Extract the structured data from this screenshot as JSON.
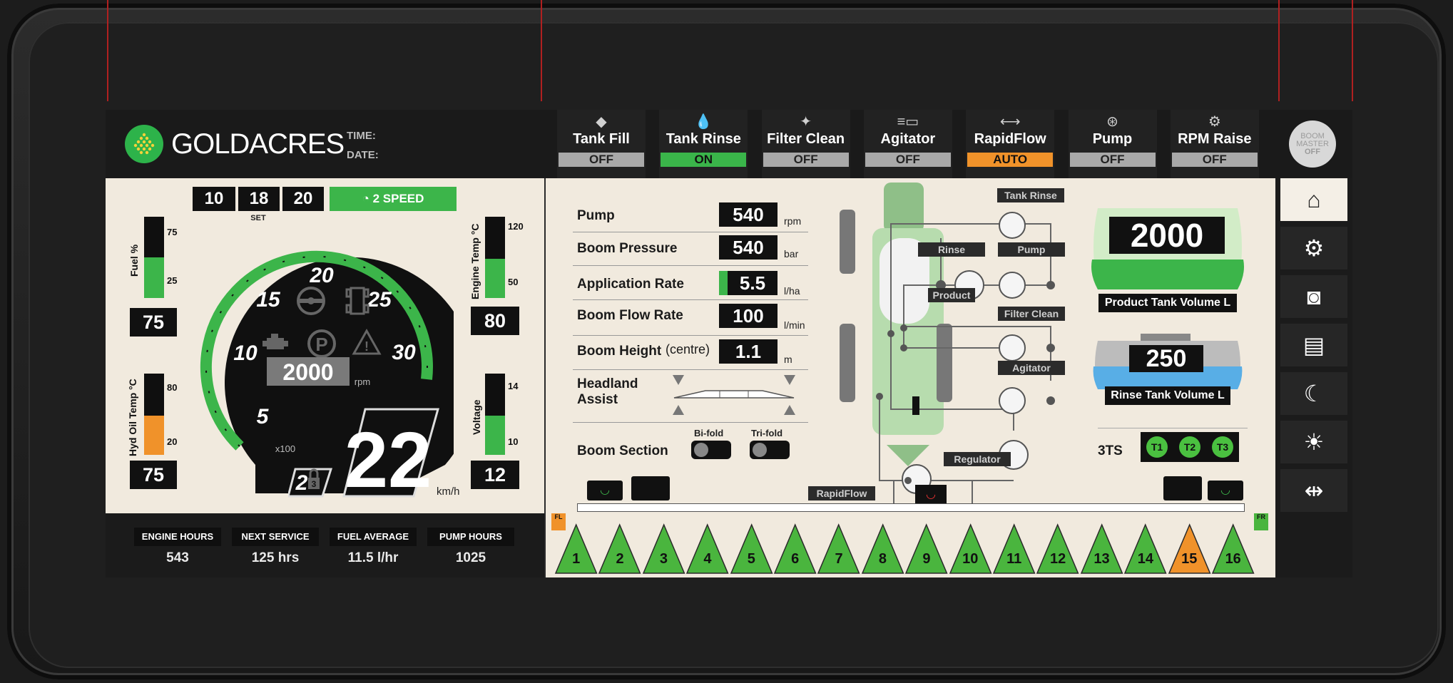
{
  "brand": {
    "name": "GOLDACRES"
  },
  "header": {
    "time_label": "TIME:",
    "date_label": "DATE:"
  },
  "functions": [
    {
      "label": "Tank Fill",
      "state": "OFF",
      "state_color": "#a9a9a9",
      "icon": "tank-fill-icon"
    },
    {
      "label": "Tank Rinse",
      "state": "ON",
      "state_color": "#3ab54a",
      "icon": "tank-rinse-icon"
    },
    {
      "label": "Filter Clean",
      "state": "OFF",
      "state_color": "#a9a9a9",
      "icon": "filter-clean-icon"
    },
    {
      "label": "Agitator",
      "state": "OFF",
      "state_color": "#a9a9a9",
      "icon": "agitator-icon"
    },
    {
      "label": "RapidFlow",
      "state": "AUTO",
      "state_color": "#f0922a",
      "icon": "rapidflow-icon"
    },
    {
      "label": "Pump",
      "state": "OFF",
      "state_color": "#a9a9a9",
      "icon": "pump-icon"
    },
    {
      "label": "RPM Raise",
      "state": "OFF",
      "state_color": "#a9a9a9",
      "icon": "rpm-raise-icon"
    }
  ],
  "boom_master": {
    "line1": "BOOM",
    "line2": "MASTER",
    "line3": "OFF"
  },
  "speed_set": {
    "values": [
      "10",
      "18",
      "20"
    ],
    "label": "SET",
    "mode": "2 SPEED"
  },
  "gauges": {
    "fuel": {
      "label": "Fuel %",
      "ticks": [
        "75",
        "25"
      ],
      "value": "75",
      "level_pct": 50
    },
    "engine_temp": {
      "label": "Engine Temp °C",
      "ticks": [
        "120",
        "50"
      ],
      "value": "80",
      "level_pct": 48
    },
    "hyd_oil_temp": {
      "label": "Hyd Oil Temp °C",
      "ticks": [
        "80",
        "20"
      ],
      "value": "75",
      "level_pct": 48
    },
    "voltage": {
      "label": "Voltage",
      "ticks": [
        "14",
        "10"
      ],
      "value": "12",
      "level_pct": 48
    }
  },
  "tacho": {
    "ticks": [
      "5",
      "10",
      "15",
      "20",
      "25",
      "30"
    ],
    "rpm": "2000",
    "rpm_unit": "rpm",
    "multiplier": "x100",
    "speed": "22",
    "speed_unit": "km/h",
    "gear": "2",
    "gear_lock": "3"
  },
  "stats": [
    {
      "label": "ENGINE HOURS",
      "value": "543"
    },
    {
      "label": "NEXT SERVICE",
      "value": "125 hrs"
    },
    {
      "label": "FUEL AVERAGE",
      "value": "11.5 l/hr"
    },
    {
      "label": "PUMP HOURS",
      "value": "1025"
    }
  ],
  "readings": [
    {
      "label": "Pump",
      "value": "540",
      "unit": "rpm"
    },
    {
      "label": "Boom Pressure",
      "value": "540",
      "unit": "bar"
    },
    {
      "label": "Application Rate",
      "value": "5.5",
      "unit": "l/ha"
    },
    {
      "label": "Boom Flow Rate",
      "value": "100",
      "unit": "l/min"
    },
    {
      "label": "Boom Height",
      "sub": "(centre)",
      "value": "1.1",
      "unit": "m"
    }
  ],
  "headland": {
    "line1": "Headland",
    "line2": "Assist"
  },
  "boom_section": {
    "label": "Boom Section",
    "bifold": "Bi-fold",
    "trifold": "Tri-fold"
  },
  "plumbing": {
    "tank_rinse": "Tank Rinse",
    "rinse": "Rinse",
    "pump": "Pump",
    "product": "Product",
    "filter_clean": "Filter Clean",
    "agitator": "Agitator",
    "regulator": "Regulator",
    "rapidflow": "RapidFlow"
  },
  "tanks": {
    "product": {
      "value": "2000",
      "label": "Product Tank Volume L",
      "color": "#3cb54a"
    },
    "rinse": {
      "value": "250",
      "label": "Rinse Tank Volume L",
      "color": "#58aee6"
    }
  },
  "threets": {
    "label": "3TS",
    "items": [
      "T1",
      "T2",
      "T3"
    ]
  },
  "sections": {
    "left_tag": "FL",
    "right_tag": "FR",
    "items": [
      "1",
      "2",
      "3",
      "4",
      "5",
      "6",
      "7",
      "8",
      "9",
      "10",
      "11",
      "12",
      "13",
      "14",
      "15",
      "16"
    ],
    "active_color": "#4ab53e",
    "alert_color": "#f0922a",
    "alert_index": 14
  },
  "nav": [
    "home-icon",
    "settings-icon",
    "camera-icon",
    "document-icon",
    "night-mode-icon",
    "brightness-icon",
    "boom-width-icon"
  ],
  "colors": {
    "green": "#3cb54a",
    "orange": "#f0922a",
    "dark": "#111111",
    "screen_bg": "#f1eade"
  }
}
